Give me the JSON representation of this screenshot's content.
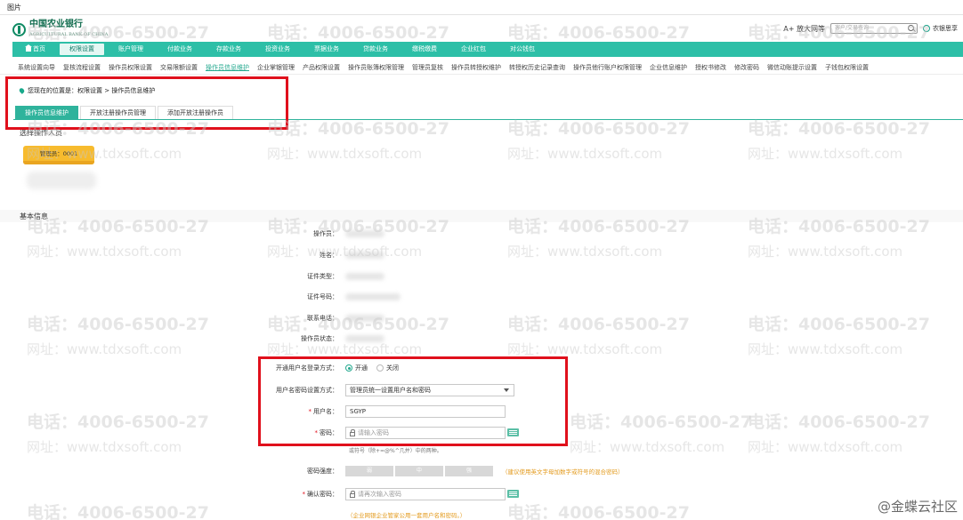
{
  "caption": "图片",
  "brand": {
    "name": "中国农业银行",
    "subtitle": "AGRICULTURAL BANK OF CHINA"
  },
  "header": {
    "font_toggle": "A+ 放大网等",
    "search_placeholder": "客户/交易查询",
    "user": "农银思享"
  },
  "main_nav": [
    {
      "label": "首页",
      "active": false
    },
    {
      "label": "权限设置",
      "active": true
    },
    {
      "label": "账户管理",
      "active": false
    },
    {
      "label": "付款业务",
      "active": false
    },
    {
      "label": "存款业务",
      "active": false
    },
    {
      "label": "投资业务",
      "active": false
    },
    {
      "label": "票据业务",
      "active": false
    },
    {
      "label": "贷款业务",
      "active": false
    },
    {
      "label": "缴税缴费",
      "active": false
    },
    {
      "label": "企业红包",
      "active": false
    },
    {
      "label": "对公钱包",
      "active": false
    }
  ],
  "sub_nav": [
    "系统设置向导",
    "复核流程设置",
    "操作员权限设置",
    "交易限额设置",
    "操作员信息维护",
    "企业掌银管理",
    "产品权限设置",
    "操作员账簿权限管理",
    "管理员复核",
    "操作员转授权维护",
    "转授权历史记录查询",
    "操作员他行账户权限管理",
    "企业信息维护",
    "授权书修改",
    "修改密码",
    "微信动账提示设置",
    "子钱包权限设置"
  ],
  "sub_nav_active": "操作员信息维护",
  "breadcrumb": "您现在的位置是：权限设置 > 操作员信息维护",
  "tabs": [
    {
      "label": "操作员信息维护",
      "active": true
    },
    {
      "label": "开放注册操作员管理",
      "active": false
    },
    {
      "label": "添加开放注册操作员",
      "active": false
    }
  ],
  "choose_operator": {
    "title": "选择操作人员",
    "chip": "管理员：0001"
  },
  "basic_info": {
    "title": "基本信息",
    "fields": [
      "操作员：",
      "姓名：",
      "证件类型：",
      "证件号码：",
      "联系电话：",
      "操作员状态："
    ]
  },
  "login_form": {
    "open_login_label": "开通用户名登录方式：",
    "radio_on": "开通",
    "radio_off": "关闭",
    "pwd_setting_label": "用户名密码设置方式：",
    "pwd_setting_value": "管理员统一设置用户名和密码",
    "username_label": "用户名：",
    "username_value": "SGYP",
    "password_label": "密码：",
    "password_placeholder": "请输入密码",
    "password_hint": "或符号（除+=@%^几并）中的两种。",
    "strength_label": "密码强度：",
    "strength_levels": [
      "弱",
      "中",
      "强"
    ],
    "strength_tip": "（建议使用英文字母加数字或符号的混合密码）",
    "confirm_label": "确认密码：",
    "confirm_placeholder": "请再次输入密码",
    "warn_tip": "（企业网银企业管家公用一套用户名和密码。）"
  },
  "watermark": {
    "phone": "电话：4006-6500-27",
    "site": "网址：www.tdxsoft.com"
  },
  "corner_mark": "@金蝶云社区",
  "colors": {
    "brand_teal": "#2dbfa7",
    "highlight_red": "#e0101c",
    "chip_yellow": "#f7bb2e",
    "tip_orange": "#e39a1c"
  }
}
